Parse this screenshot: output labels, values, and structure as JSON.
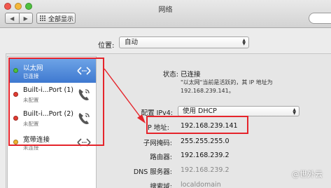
{
  "window": {
    "title": "网络"
  },
  "toolbar": {
    "back_icon": "chevron-left-icon",
    "forward_icon": "chevron-right-icon",
    "show_all_label": "全部显示"
  },
  "location": {
    "label": "位置:",
    "value": "自动"
  },
  "services": [
    {
      "name": "以太网",
      "status": "已连接",
      "dot_color": "#4cc23c",
      "icon": "ethernet-arrows-icon",
      "selected": true
    },
    {
      "name": "Built-i...Port (1)",
      "status": "未配置",
      "dot_color": "#e23b32",
      "icon": "phone-icon",
      "selected": false
    },
    {
      "name": "Built-i...Port (2)",
      "status": "未配置",
      "dot_color": "#e23b32",
      "icon": "phone-icon",
      "selected": false
    },
    {
      "name": "宽带连接",
      "status": "未连接",
      "dot_color": "#f0b12e",
      "icon": "ethernet-arrows-icon",
      "selected": false
    }
  ],
  "detail": {
    "status_label": "状态:",
    "status_value": "已连接",
    "status_note_1": "\"以太网\"当前是活跃的，其 IP 地址为",
    "status_note_2": "192.168.239.141。",
    "config_label": "配置 IPv4:",
    "config_value": "使用 DHCP",
    "ip_label": "IP 地址:",
    "ip_value": "192.168.239.141",
    "mask_label": "子网掩码:",
    "mask_value": "255.255.255.0",
    "router_label": "路由器:",
    "router_value": "192.168.239.2",
    "dns_label": "DNS 服务器:",
    "dns_value": "192.168.239.2",
    "domain_label": "搜索域:",
    "domain_value": "localdomain"
  },
  "watermark": {
    "text": "@世外云"
  },
  "colors": {
    "highlight": "#e5242b",
    "selection": "#3f79d0"
  }
}
